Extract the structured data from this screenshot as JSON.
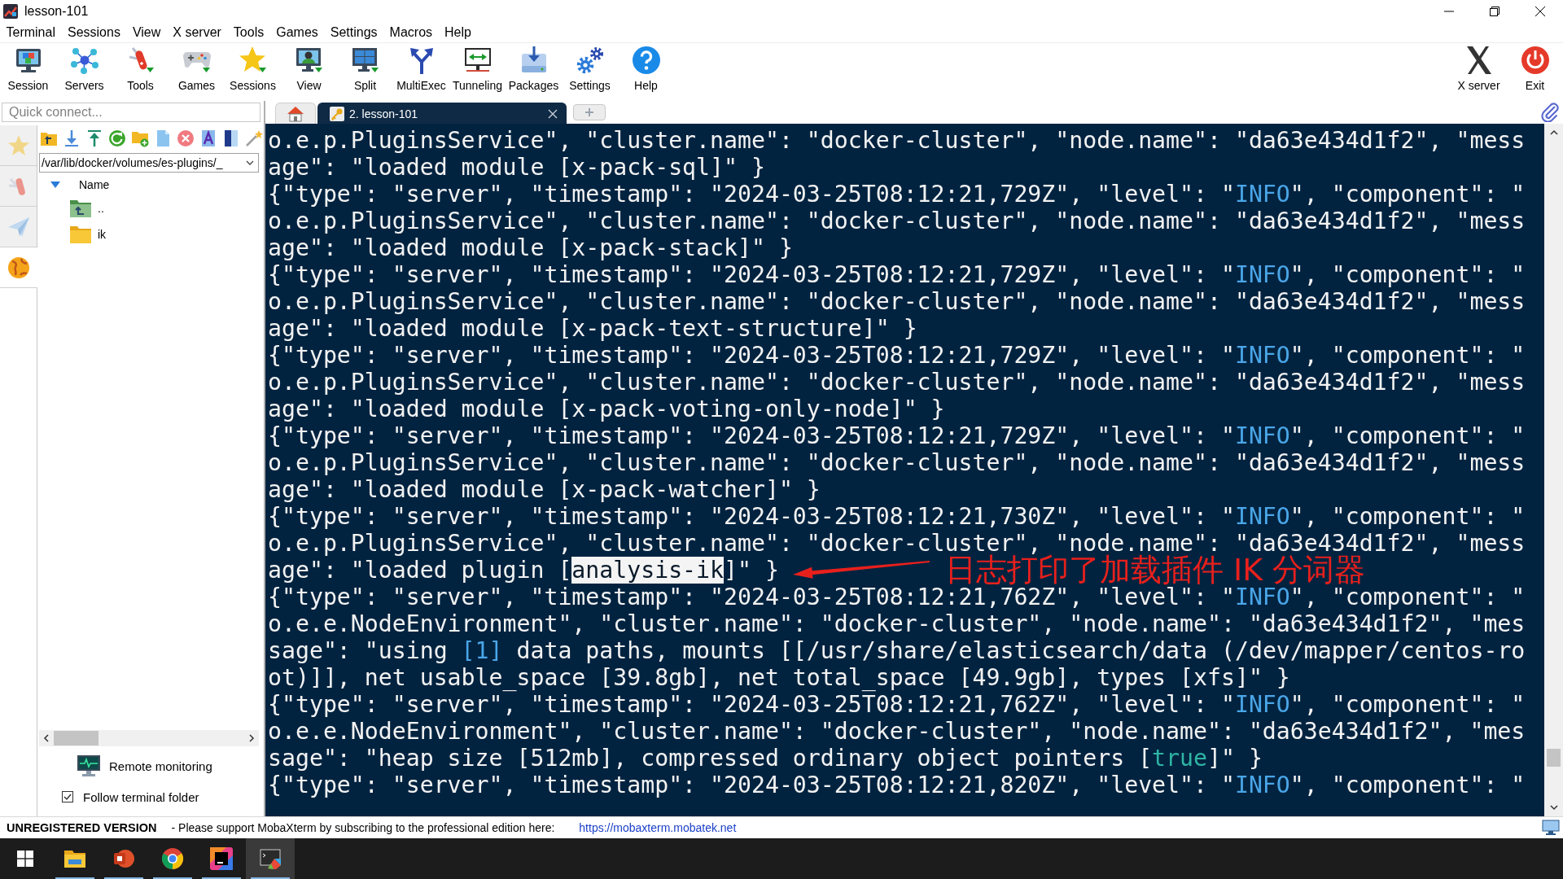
{
  "window": {
    "title": "lesson-101"
  },
  "menu": [
    "Terminal",
    "Sessions",
    "View",
    "X server",
    "Tools",
    "Games",
    "Settings",
    "Macros",
    "Help"
  ],
  "toolbar": {
    "buttons": [
      "Session",
      "Servers",
      "Tools",
      "Games",
      "Sessions",
      "View",
      "Split",
      "MultiExec",
      "Tunneling",
      "Packages",
      "Settings",
      "Help"
    ],
    "right_buttons": [
      "X server",
      "Exit"
    ]
  },
  "sidebar": {
    "quick_connect": {
      "placeholder": "Quick connect..."
    },
    "side_tabs": [
      {
        "selected": false
      },
      {
        "selected": false
      },
      {
        "selected": false
      },
      {
        "selected": true
      }
    ],
    "path": "/var/lib/docker/volumes/es-plugins/_",
    "file_list": {
      "column": "Name",
      "items": [
        {
          "name": "..",
          "kind": "parent"
        },
        {
          "name": "ik",
          "kind": "folder"
        }
      ]
    },
    "remote_monitoring": "Remote monitoring",
    "follow_terminal_folder": {
      "label": "Follow terminal folder",
      "checked": true
    }
  },
  "tabs": [
    {
      "kind": "home",
      "selected": false
    },
    {
      "kind": "session",
      "label": "2. lesson-101",
      "selected": true
    }
  ],
  "terminal": {
    "lines": [
      [
        {
          "text": "o.e.p.PluginsService\", \"cluster.name\": \"docker-cluster\", \"node.name\": \"da63e434d1f2\", \"mess"
        }
      ],
      [
        {
          "text": "age\": \"loaded module [x-pack-sql]\" }"
        }
      ],
      [
        {
          "text": "{\"type\": \"server\", \"timestamp\": \"2024-03-25T08:12:21,729Z\", \"level\": \""
        },
        {
          "text": "INFO",
          "kind": "accent"
        },
        {
          "text": "\", \"component\": \""
        }
      ],
      [
        {
          "text": "o.e.p.PluginsService\", \"cluster.name\": \"docker-cluster\", \"node.name\": \"da63e434d1f2\", \"mess"
        }
      ],
      [
        {
          "text": "age\": \"loaded module [x-pack-stack]\" }"
        }
      ],
      [
        {
          "text": "{\"type\": \"server\", \"timestamp\": \"2024-03-25T08:12:21,729Z\", \"level\": \""
        },
        {
          "text": "INFO",
          "kind": "accent"
        },
        {
          "text": "\", \"component\": \""
        }
      ],
      [
        {
          "text": "o.e.p.PluginsService\", \"cluster.name\": \"docker-cluster\", \"node.name\": \"da63e434d1f2\", \"mess"
        }
      ],
      [
        {
          "text": "age\": \"loaded module [x-pack-text-structure]\" }"
        }
      ],
      [
        {
          "text": "{\"type\": \"server\", \"timestamp\": \"2024-03-25T08:12:21,729Z\", \"level\": \""
        },
        {
          "text": "INFO",
          "kind": "accent"
        },
        {
          "text": "\", \"component\": \""
        }
      ],
      [
        {
          "text": "o.e.p.PluginsService\", \"cluster.name\": \"docker-cluster\", \"node.name\": \"da63e434d1f2\", \"mess"
        }
      ],
      [
        {
          "text": "age\": \"loaded module [x-pack-voting-only-node]\" }"
        }
      ],
      [
        {
          "text": "{\"type\": \"server\", \"timestamp\": \"2024-03-25T08:12:21,729Z\", \"level\": \""
        },
        {
          "text": "INFO",
          "kind": "accent"
        },
        {
          "text": "\", \"component\": \""
        }
      ],
      [
        {
          "text": "o.e.p.PluginsService\", \"cluster.name\": \"docker-cluster\", \"node.name\": \"da63e434d1f2\", \"mess"
        }
      ],
      [
        {
          "text": "age\": \"loaded module [x-pack-watcher]\" }"
        }
      ],
      [
        {
          "text": "{\"type\": \"server\", \"timestamp\": \"2024-03-25T08:12:21,730Z\", \"level\": \""
        },
        {
          "text": "INFO",
          "kind": "accent"
        },
        {
          "text": "\", \"component\": \""
        }
      ],
      [
        {
          "text": "o.e.p.PluginsService\", \"cluster.name\": \"docker-cluster\", \"node.name\": \"da63e434d1f2\", \"mess"
        }
      ],
      [
        {
          "text": "age\": \"loaded plugin ["
        },
        {
          "text": "analysis-ik",
          "kind": "selection"
        },
        {
          "text": "]\" }"
        }
      ],
      [
        {
          "text": "{\"type\": \"server\", \"timestamp\": \"2024-03-25T08:12:21,762Z\", \"level\": \""
        },
        {
          "text": "INFO",
          "kind": "accent"
        },
        {
          "text": "\", \"component\": \""
        }
      ],
      [
        {
          "text": "o.e.e.NodeEnvironment\", \"cluster.name\": \"docker-cluster\", \"node.name\": \"da63e434d1f2\", \"mes"
        }
      ],
      [
        {
          "text": "sage\": \"using "
        },
        {
          "text": "[1]",
          "kind": "accent"
        },
        {
          "text": " data paths, mounts [[/usr/share/elasticsearch/data (/dev/mapper/centos-ro"
        }
      ],
      [
        {
          "text": "ot)]], net usable_space [39.8gb], net total_space [49.9gb], types [xfs]\" }"
        }
      ],
      [
        {
          "text": "{\"type\": \"server\", \"timestamp\": \"2024-03-25T08:12:21,762Z\", \"level\": \""
        },
        {
          "text": "INFO",
          "kind": "accent"
        },
        {
          "text": "\", \"component\": \""
        }
      ],
      [
        {
          "text": "o.e.e.NodeEnvironment\", \"cluster.name\": \"docker-cluster\", \"node.name\": \"da63e434d1f2\", \"mes"
        }
      ],
      [
        {
          "text": "sage\": \"heap size [512mb], compressed ordinary object pointers ["
        },
        {
          "text": "true",
          "kind": "literal"
        },
        {
          "text": "]\" }"
        }
      ],
      [
        {
          "text": "{\"type\": \"server\", \"timestamp\": \"2024-03-25T08:12:21,820Z\", \"level\": \""
        },
        {
          "text": "INFO",
          "kind": "accent"
        },
        {
          "text": "\", \"component\": \""
        }
      ]
    ],
    "annotation": "日志打印了加载插件 IK 分词器"
  },
  "status_bar": {
    "edition": "UNREGISTERED VERSION",
    "message": "- Please support MobaXterm by subscribing to the professional edition here:",
    "link": "https://mobaxterm.mobatek.net"
  },
  "taskbar": {
    "apps": [
      {
        "running": true,
        "selected": false
      },
      {
        "running": true,
        "selected": false
      },
      {
        "running": true,
        "selected": false
      },
      {
        "running": true,
        "selected": false
      },
      {
        "running": true,
        "selected": true
      }
    ]
  }
}
